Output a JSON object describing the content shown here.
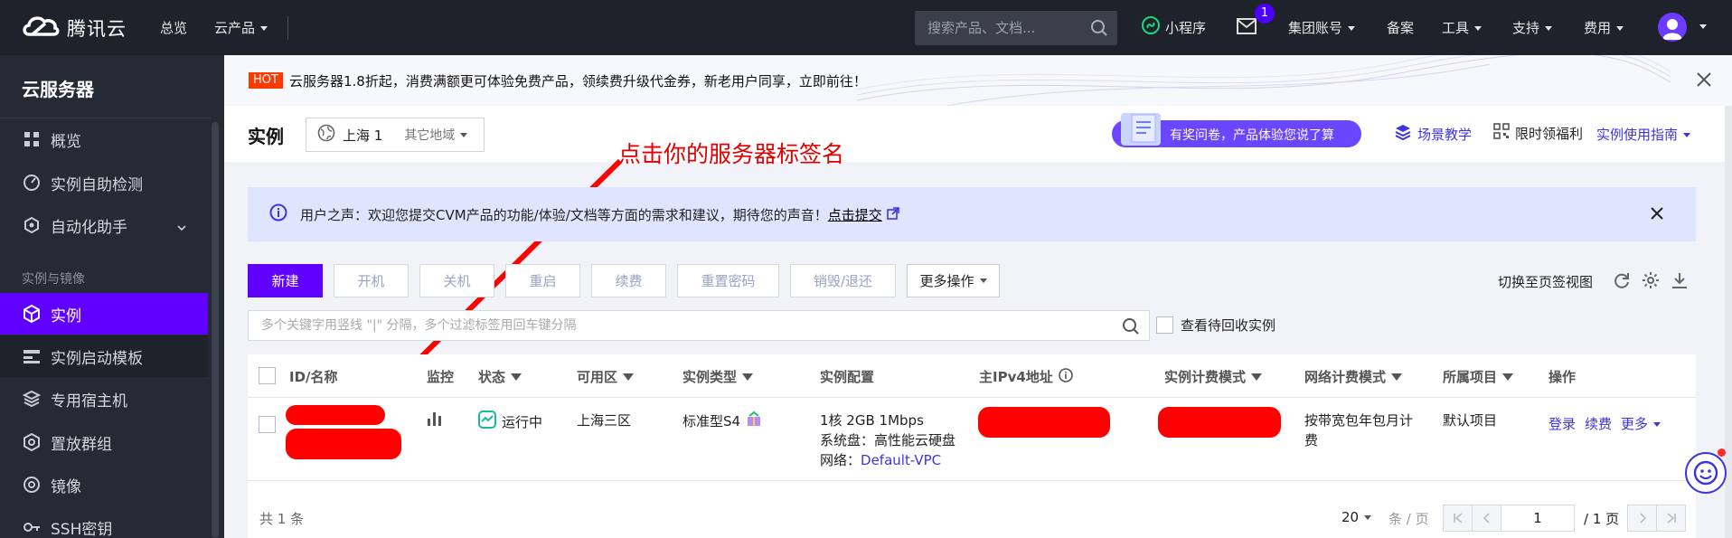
{
  "colors": {
    "accent": "#6000ff",
    "topbar": "#1e222b",
    "sidebar": "#262a35",
    "annotation": "#ff0000",
    "link": "#3d34e0"
  },
  "topnav": {
    "brand": "腾讯云",
    "overview": "总览",
    "products": "云产品",
    "search_placeholder": "搜索产品、文档...",
    "miniprogram": "小程序",
    "mail_count": "1",
    "group_account": "集团账号",
    "beian": "备案",
    "tools": "工具",
    "support": "支持",
    "billing": "费用"
  },
  "sidebar": {
    "title": "云服务器",
    "items": [
      {
        "label": "概览",
        "icon": "grid-icon"
      },
      {
        "label": "实例自助检测",
        "icon": "gauge-icon"
      },
      {
        "label": "自动化助手",
        "icon": "robot-icon"
      },
      {
        "label": "实例",
        "icon": "cube-icon"
      },
      {
        "label": "实例启动模板",
        "icon": "template-icon"
      },
      {
        "label": "专用宿主机",
        "icon": "layers-icon"
      },
      {
        "label": "置放群组",
        "icon": "hexagon-icon"
      },
      {
        "label": "镜像",
        "icon": "disc-icon"
      },
      {
        "label": "SSH密钥",
        "icon": "key-icon"
      }
    ],
    "group_label": "实例与镜像"
  },
  "banner": {
    "hot": "HOT",
    "text": "云服务器1.8折起，消费满额更可体验免费产品，领续费升级代金券，新老用户同享，立即前往！"
  },
  "header": {
    "title": "实例",
    "region": "上海 1",
    "region_other": "其它地域",
    "survey": "有奖问卷，产品体验您说了算",
    "scene_teaching": "场景教学",
    "limited_benefit": "限时领福利",
    "usage_guide": "实例使用指南"
  },
  "annotation": {
    "text": "点击你的服务器标签名"
  },
  "alert": {
    "text": "用户之声：欢迎您提交CVM产品的功能/体验/文档等方面的需求和建议，期待您的声音！",
    "link": "点击提交"
  },
  "toolbar": {
    "new": "新建",
    "start": "开机",
    "stop": "关机",
    "restart": "重启",
    "renew": "续费",
    "reset_password": "重置密码",
    "destroy": "销毁/退还",
    "more": "更多操作",
    "switch_view": "切换至页签视图"
  },
  "filter": {
    "placeholder": "多个关键字用竖线 \"|\" 分隔，多个过滤标签用回车键分隔",
    "recycle": "查看待回收实例"
  },
  "table": {
    "headers": {
      "id": "ID/名称",
      "monitor": "监控",
      "status": "状态",
      "zone": "可用区",
      "type": "实例类型",
      "config": "实例配置",
      "ip": "主IPv4地址",
      "billing": "实例计费模式",
      "net_billing": "网络计费模式",
      "project": "所属项目",
      "ops": "操作"
    },
    "row": {
      "status": "运行中",
      "zone": "上海三区",
      "type": "标准型S4",
      "config_line1": "1核 2GB 1Mbps",
      "config_line2": "系统盘：高性能云硬盘",
      "config_line3_prefix": "网络：",
      "vpc": "Default-VPC",
      "net_billing_line1": "按带宽包年包月计",
      "net_billing_line2": "费",
      "project": "默认项目",
      "op_login": "登录",
      "op_renew": "续费",
      "op_more": "更多"
    },
    "footer": {
      "total": "共 1 条",
      "page_size": "20",
      "per_page": "条 / 页",
      "current_page": "1",
      "total_pages": "/ 1 页"
    }
  }
}
